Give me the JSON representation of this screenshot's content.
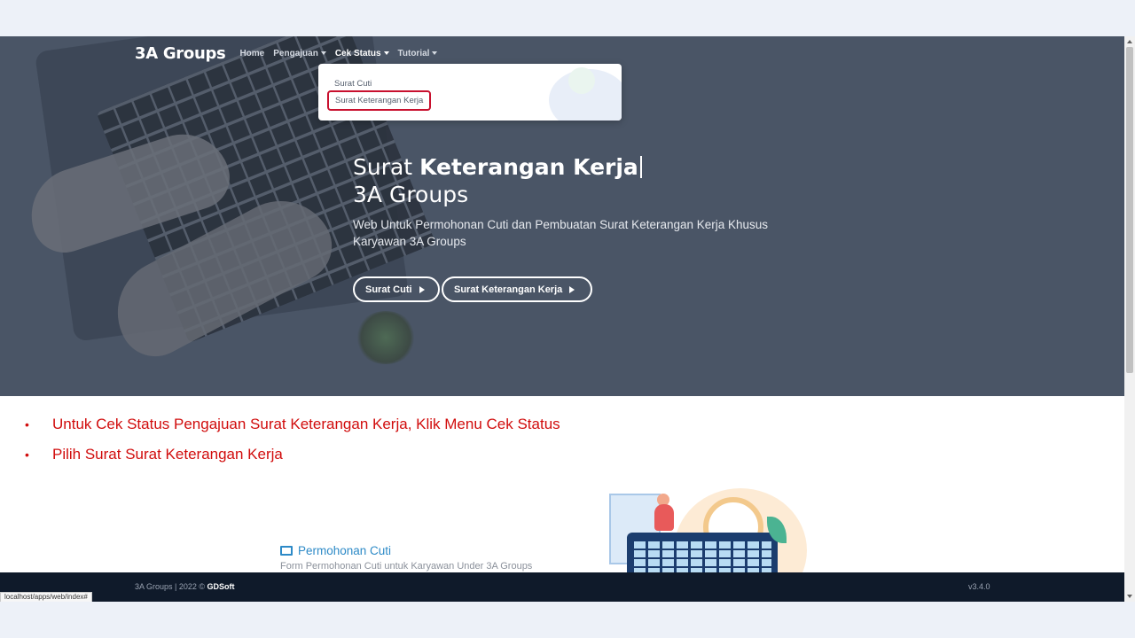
{
  "navbar": {
    "brand": "3A Groups",
    "items": [
      {
        "label": "Home"
      },
      {
        "label": "Pengajuan"
      },
      {
        "label": "Cek Status"
      },
      {
        "label": "Tutorial"
      }
    ]
  },
  "dropdown": {
    "items": [
      {
        "label": "Surat Cuti"
      },
      {
        "label": "Surat Keterangan Kerja"
      }
    ]
  },
  "hero": {
    "title_prefix": "Surat",
    "title_bold": "Keterangan Kerja",
    "subtitle": "3A Groups",
    "description": "Web Untuk Permohonan Cuti dan Pembuatan Surat Keterangan Kerja Khusus Karyawan 3A Groups",
    "buttons": [
      {
        "label": "Surat Cuti"
      },
      {
        "label": "Surat Keterangan Kerja"
      }
    ]
  },
  "instructions": [
    "Untuk Cek Status Pengajuan Surat Keterangan Kerja, Klik  Menu Cek Status",
    "Pilih  Surat Surat Keterangan Kerja"
  ],
  "section": {
    "title": "Permohonan Cuti",
    "description": "Form Permohonan Cuti untuk Karyawan Under 3A Groups"
  },
  "footer": {
    "copyright": "3A Groups | 2022 ©",
    "company": "GDSoft",
    "version": "v3.4.0"
  },
  "status_url": "localhost/apps/web/index#",
  "colors": {
    "hero_bg": "#4a5566",
    "instruction_text": "#d10d0d",
    "highlight_border": "#c8102e",
    "footer_bg": "#0f1a2a",
    "link_blue": "#2d8ac7"
  }
}
